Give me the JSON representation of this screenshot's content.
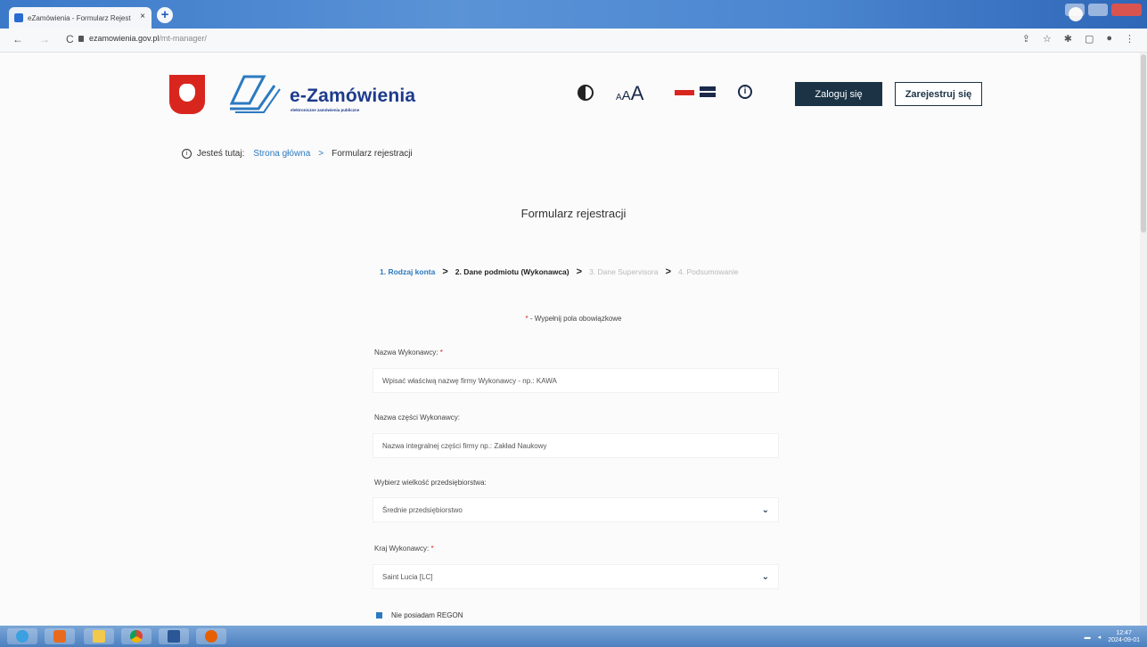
{
  "browser": {
    "tab_title": "eZamówienia - Formularz Rejest",
    "tab_close": "×",
    "new_tab": "+",
    "url_domain": "ezamowienia.gov.pl",
    "url_path": "/mt-manager/",
    "nav_back": "←",
    "nav_forward": "→",
    "nav_reload": "C",
    "icons": [
      "share-icon",
      "star-icon",
      "extensions-icon",
      "sidepanel-icon",
      "profile-icon",
      "menu-icon"
    ]
  },
  "header": {
    "brand": "e-Zamówienia",
    "brand_sub": "elektroniczne zamówienia publiczne",
    "font_small": "A",
    "font_medium": "A",
    "font_large": "A",
    "info_symbol": "i",
    "login_label": "Zaloguj się",
    "register_label": "Zarejestruj się"
  },
  "breadcrumb": {
    "info_symbol": "i",
    "prefix": "Jesteś tutaj:",
    "home": "Strona główna",
    "separator": ">",
    "current": "Formularz rejestracji"
  },
  "form": {
    "title": "Formularz rejestracji",
    "steps": [
      {
        "label": "1. Rodzaj konta",
        "state": "active"
      },
      {
        "label": "2. Dane podmiotu (Wykonawca)",
        "state": "done"
      },
      {
        "label": "3. Dane Supervisora",
        "state": "disabled"
      },
      {
        "label": "4. Podsumowanie",
        "state": "disabled"
      }
    ],
    "step_separator": ">",
    "required_star": "*",
    "required_note": " - Wypełnij pola obowiązkowe",
    "fields": [
      {
        "label": "Nazwa Wykonawcy:",
        "required": "*",
        "value": "Wpisać właściwą nazwę firmy Wykonawcy - np.: KAWA"
      },
      {
        "label": "Nazwa części Wykonawcy:",
        "required": "",
        "value": "Nazwa integralnej części firmy np.: Zakład Naukowy"
      },
      {
        "label": "Wybierz wielkość przedsiębiorstwa:",
        "required": "",
        "value": "Średnie przedsiębiorstwo"
      },
      {
        "label": "Kraj Wykonawcy:",
        "required": "*",
        "value": "Saint Lucia [LC]"
      }
    ],
    "checkbox_label": "Nie posiadam REGON"
  },
  "taskbar": {
    "clock": "12:47",
    "date": "2024-09-01"
  },
  "colors": {
    "accent": "#2c7ac0",
    "brand": "#1d3b8c",
    "primary_button": "#1b3345",
    "required": "#d8261f"
  }
}
